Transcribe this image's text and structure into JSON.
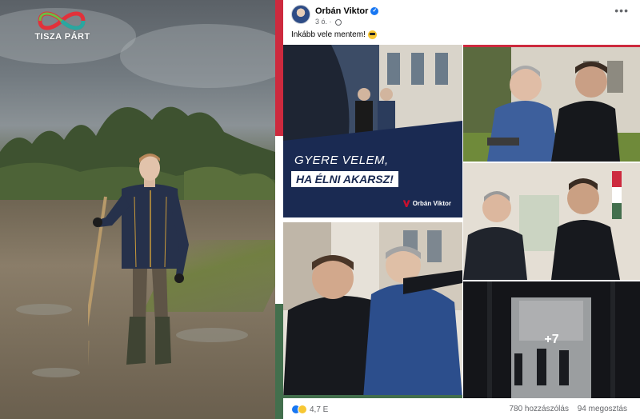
{
  "left_photo": {
    "logo_text": "TISZA PÁRT",
    "logo_colors": {
      "red": "#e2313a",
      "teal": "#2aa7a0",
      "green": "#6abd45"
    }
  },
  "post": {
    "author": "Orbán Viktor",
    "verified_icon": "verified-badge-icon",
    "timestamp": "3 ó.",
    "privacy_icon": "globe-icon",
    "more_label": "•••",
    "text": "Inkább vele mentem!",
    "text_emoji": "sunglasses-emoji",
    "slogan_line1": "GYERE VELEM,",
    "slogan_line2": "HA ÉLNI AKARSZ!",
    "brand_label": "Orbán Viktor",
    "more_photos": "+7",
    "reactions_count": "4,7 E",
    "comments": "780 hozzászólás",
    "shares": "94 megosztás",
    "colors": {
      "flag_red": "#cd2a3e",
      "flag_white": "#ffffff",
      "flag_green": "#436f4d",
      "navy": "#1a2a52",
      "link_blue": "#1877f2"
    }
  }
}
